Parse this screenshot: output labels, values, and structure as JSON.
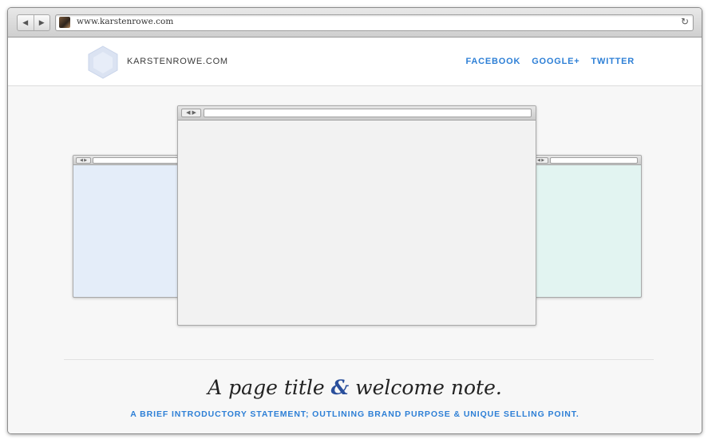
{
  "browser": {
    "back_glyph": "◀",
    "forward_glyph": "▶",
    "url": "www.karstenrowe.com",
    "reload_glyph": "↻",
    "favicon_icon": "profile-photo"
  },
  "header": {
    "brand": "KARSTENROWE.COM",
    "nav": [
      "FACEBOOK",
      "GOOGLE+",
      "TWITTER"
    ],
    "accent_color": "#2d7fd6"
  },
  "hero": {
    "mock_back_glyph": "◀ ▶",
    "colors": {
      "left_mock": "#e4edf9",
      "center_mock": "#f2f2f2",
      "right_mock": "#e2f4f1"
    }
  },
  "content": {
    "title_part1": "A page title ",
    "title_amp": "&",
    "title_part2": " welcome note.",
    "subtitle": "A BRIEF INTRODUCTORY STATEMENT; OUTLINING BRAND PURPOSE & UNIQUE SELLING POINT."
  }
}
